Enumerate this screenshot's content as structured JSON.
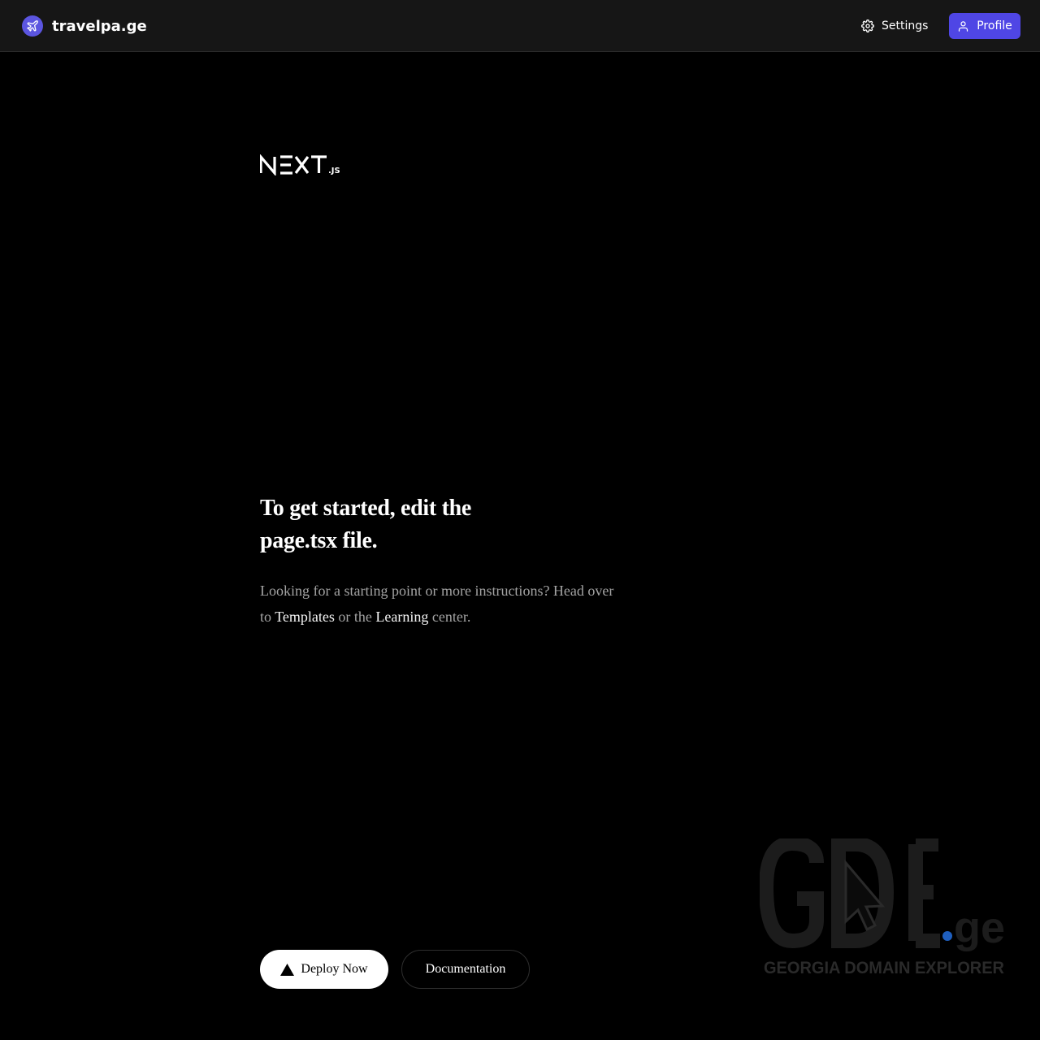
{
  "header": {
    "brand_name": "travelpa.ge",
    "settings_label": "Settings",
    "profile_label": "Profile",
    "accent_color": "#4f46e5"
  },
  "main": {
    "logo_text": "NEXT.JS",
    "heading": "To get started, edit the page.tsx file.",
    "paragraph": {
      "text_before": "Looking for a starting point or more instructions? Head over to ",
      "templates_link": "Templates",
      "text_middle": " or the ",
      "learning_link": "Learning",
      "text_after": " center."
    },
    "deploy_label": "Deploy Now",
    "docs_label": "Documentation"
  },
  "watermark": {
    "logo_text": "GDE.ge",
    "tagline": "GEORGIA DOMAIN EXPLORER"
  }
}
